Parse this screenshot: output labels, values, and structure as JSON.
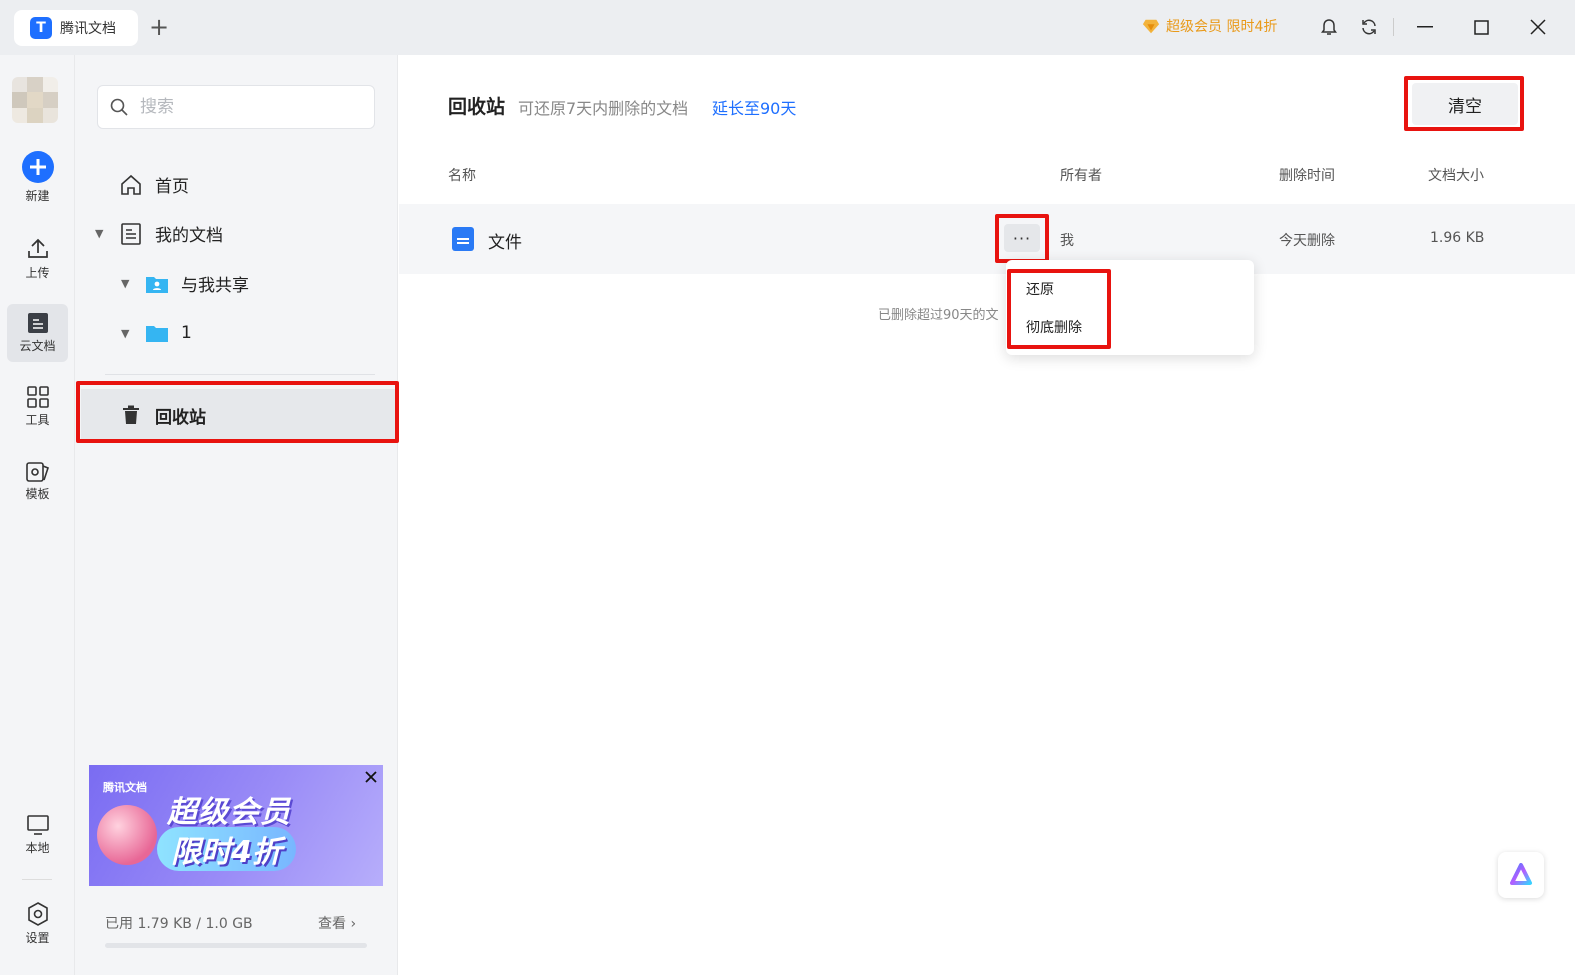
{
  "titlebar": {
    "tab_title": "腾讯文档",
    "tab_logo_text": "T",
    "new_tab": "+",
    "promo": "超级会员 限时4折",
    "promo_color": "#e99a1a",
    "icons": [
      "bell-icon",
      "sync-icon",
      "minimize-icon",
      "maximize-icon",
      "close-icon"
    ]
  },
  "rail": {
    "items": [
      {
        "label": "新建",
        "icon": "plus-circle-icon"
      },
      {
        "label": "上传",
        "icon": "upload-icon"
      },
      {
        "label": "云文档",
        "icon": "cloud-doc-icon"
      },
      {
        "label": "工具",
        "icon": "grid-icon"
      },
      {
        "label": "模板",
        "icon": "template-icon"
      },
      {
        "label": "本地",
        "icon": "monitor-icon"
      },
      {
        "label": "设置",
        "icon": "settings-icon"
      }
    ]
  },
  "sidebar": {
    "search_placeholder": "搜索",
    "nav": {
      "home": "首页",
      "my_docs": "我的文档",
      "shared": "与我共享",
      "folder1": "1",
      "trash": "回收站"
    },
    "banner": {
      "logo": "腾讯文档",
      "line1": "超级会员",
      "line2": "限时4折"
    },
    "usage": {
      "text": "已用 1.79 KB / 1.0 GB",
      "link": "查看 ›",
      "fraction": 1.7e-06
    }
  },
  "main": {
    "title": "回收站",
    "subtitle": "可还原7天内删除的文档",
    "extend_link": "延长至90天",
    "clear_button": "清空",
    "columns": {
      "name": "名称",
      "owner": "所有者",
      "deleted": "删除时间",
      "size": "文档大小"
    },
    "rows": [
      {
        "name": "文件",
        "owner": "我",
        "deleted": "今天删除",
        "size": "1.96 KB"
      }
    ],
    "note": "已删除超过90天的文",
    "more": "···",
    "context_menu": {
      "restore": "还原",
      "delete_forever": "彻底删除"
    },
    "accent": "#1e6fff",
    "highlight": "#e8130f"
  }
}
